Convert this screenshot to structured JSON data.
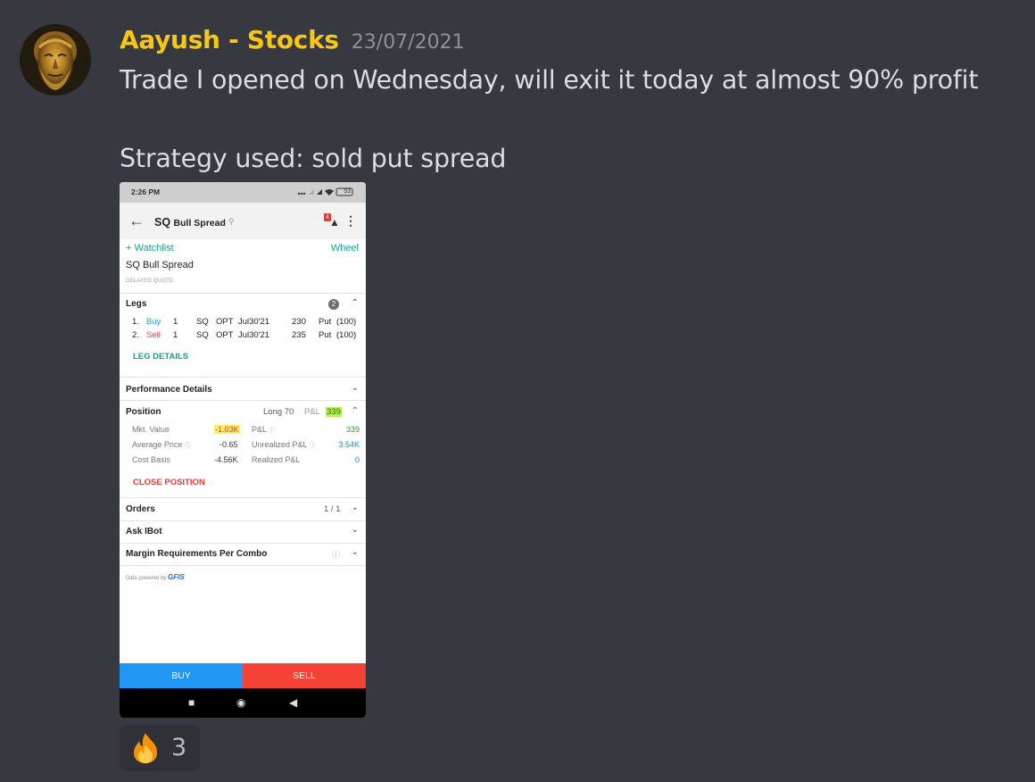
{
  "message": {
    "author": "Aayush - Stocks",
    "timestamp": "23/07/2021",
    "lines": [
      "Trade I opened on Wednesday, will exit it today at almost 90% profit",
      "Strategy used: sold put spread"
    ],
    "author_color": "#f9c613"
  },
  "screenshot": {
    "status_time": "2:26 PM",
    "battery": "53",
    "header_title": "SQ",
    "header_subtitle": "Bull Spread",
    "notification_count": "4",
    "watchlist_label": "+ Watchlist",
    "wheel_label": "Wheel",
    "symbol_name": "SQ Bull Spread",
    "delayed_label": "DELAYED QUOTE",
    "legs": {
      "title": "Legs",
      "count": "2",
      "rows": [
        {
          "n": "1.",
          "action": "Buy",
          "qty": "1",
          "sym": "SQ",
          "type": "OPT",
          "expiry": "Jul30'21",
          "strike": "230",
          "right": "Put",
          "mult": "(100)"
        },
        {
          "n": "2.",
          "action": "Sell",
          "qty": "1",
          "sym": "SQ",
          "type": "OPT",
          "expiry": "Jul30'21",
          "strike": "235",
          "right": "Put",
          "mult": "(100)"
        }
      ],
      "details_link": "LEG DETAILS"
    },
    "performance_title": "Performance Details",
    "position": {
      "title": "Position",
      "long_label": "Long 70",
      "pnl_label": "P&L",
      "pnl_value": "339",
      "mkt_value_label": "Mkt. Value",
      "mkt_value": "-1.03K",
      "pnl2_label": "P&L",
      "pnl2_value": "339",
      "avg_price_label": "Average Price",
      "avg_price": "-0.65",
      "unrealized_label": "Unrealized P&L",
      "unrealized": "3.54K",
      "cost_basis_label": "Cost Basis",
      "cost_basis": "-4.56K",
      "realized_label": "Realized P&L",
      "realized": "0",
      "close_link": "CLOSE POSITION"
    },
    "orders_title": "Orders",
    "orders_count": "1 / 1",
    "askibot_title": "Ask IBot",
    "margin_title": "Margin Requirements Per Combo",
    "powered_by": "Data powered by",
    "powered_brand": "GFIS",
    "buy_label": "BUY",
    "sell_label": "SELL"
  },
  "reaction": {
    "emoji": "fire-icon",
    "count": "3"
  }
}
